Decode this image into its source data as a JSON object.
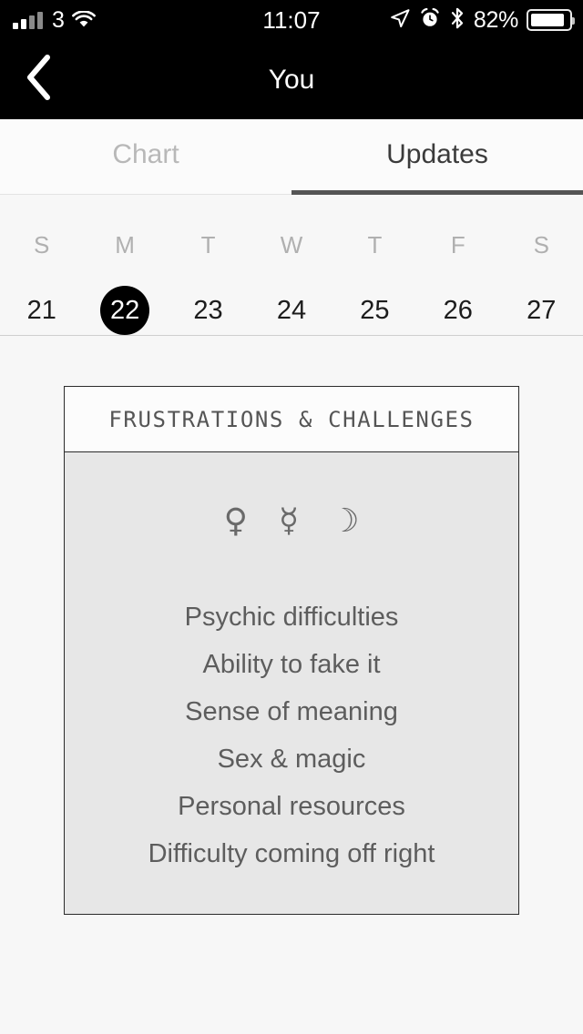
{
  "statusbar": {
    "carrier": "3",
    "signal_icon": "cellular-signal-icon",
    "wifi_icon": "wifi-icon",
    "time": "11:07",
    "location_icon": "location-arrow-icon",
    "alarm_icon": "alarm-clock-icon",
    "bluetooth_icon": "bluetooth-icon",
    "battery_percent": "82%",
    "battery_icon": "battery-icon"
  },
  "navbar": {
    "back_icon": "chevron-left-icon",
    "title": "You"
  },
  "tabs": [
    {
      "label": "Chart",
      "active": false
    },
    {
      "label": "Updates",
      "active": true
    }
  ],
  "calendar": {
    "day_initials": [
      "S",
      "M",
      "T",
      "W",
      "T",
      "F",
      "S"
    ],
    "dates": [
      "21",
      "22",
      "23",
      "24",
      "25",
      "26",
      "27"
    ],
    "selected_date": "22"
  },
  "card": {
    "title": "FRUSTRATIONS & CHALLENGES",
    "symbols": [
      {
        "glyph": "♀",
        "name": "venus-symbol"
      },
      {
        "glyph": "☿",
        "name": "mercury-symbol"
      },
      {
        "glyph": "☽",
        "name": "moon-symbol"
      }
    ],
    "lines": [
      "Psychic difficulties",
      "Ability to fake it",
      "Sense of meaning",
      "Sex & magic",
      "Personal resources",
      "Difficulty coming off right"
    ]
  },
  "colors": {
    "status_bar_bg": "#000000",
    "nav_bar_bg": "#000000",
    "page_bg": "#f7f7f7",
    "card_body_bg": "#e7e7e7",
    "card_header_bg": "#fcfcfc",
    "card_border": "#2b2b2b",
    "active_tab": "#3b3b3b",
    "inactive_tab": "#b8b8b8",
    "tab_indicator": "#555555",
    "selected_date_bg": "#000000",
    "text_muted": "#5d5d5d"
  }
}
